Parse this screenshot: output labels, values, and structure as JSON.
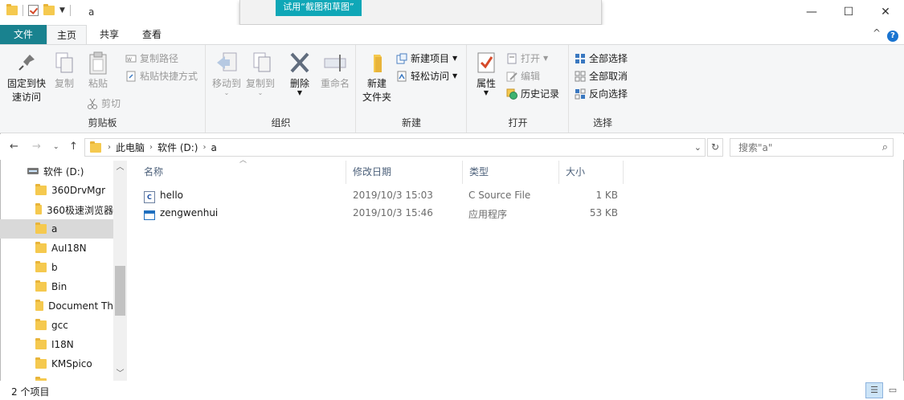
{
  "window": {
    "title": "a",
    "minimize": "—",
    "maximize": "☐",
    "close": "✕"
  },
  "popup": {
    "button": "试用“截图和草图”"
  },
  "tabs": {
    "file": "文件",
    "home": "主页",
    "share": "共享",
    "view": "查看"
  },
  "ribbon": {
    "clipboard": {
      "label": "剪贴板",
      "pin": "固定到快\n速访问",
      "pin_l1": "固定到快",
      "pin_l2": "速访问",
      "copy": "复制",
      "paste": "粘贴",
      "copy_path": "复制路径",
      "paste_shortcut": "粘贴快捷方式",
      "cut": "剪切"
    },
    "organize": {
      "label": "组织",
      "move_to": "移动到",
      "copy_to": "复制到",
      "delete": "删除",
      "rename": "重命名"
    },
    "new": {
      "label": "新建",
      "new_folder_l1": "新建",
      "new_folder_l2": "文件夹",
      "new_item": "新建项目",
      "easy_access": "轻松访问"
    },
    "open": {
      "label": "打开",
      "properties": "属性",
      "open": "打开",
      "edit": "编辑",
      "history": "历史记录"
    },
    "select": {
      "label": "选择",
      "select_all": "全部选择",
      "select_none": "全部取消",
      "invert": "反向选择"
    }
  },
  "address": {
    "crumbs": [
      "此电脑",
      "软件 (D:)",
      "a"
    ],
    "search_placeholder": "搜索\"a\""
  },
  "navpane": {
    "items": [
      {
        "label": "软件 (D:)",
        "type": "drive"
      },
      {
        "label": "360DrvMgr",
        "type": "folder"
      },
      {
        "label": "360极速浏览器",
        "type": "folder"
      },
      {
        "label": "a",
        "type": "folder",
        "selected": true
      },
      {
        "label": "AuI18N",
        "type": "folder"
      },
      {
        "label": "b",
        "type": "folder"
      },
      {
        "label": "Bin",
        "type": "folder"
      },
      {
        "label": "Document Th",
        "type": "folder"
      },
      {
        "label": "gcc",
        "type": "folder"
      },
      {
        "label": "I18N",
        "type": "folder"
      },
      {
        "label": "KMSpico",
        "type": "folder"
      }
    ]
  },
  "columns": {
    "name": "名称",
    "modified": "修改日期",
    "type": "类型",
    "size": "大小"
  },
  "files": [
    {
      "name": "hello",
      "modified": "2019/10/3 15:03",
      "type": "C Source File",
      "size": "1 KB",
      "icon": "c-source-icon"
    },
    {
      "name": "zengwenhui",
      "modified": "2019/10/3 15:46",
      "type": "应用程序",
      "size": "53 KB",
      "icon": "exe-icon"
    }
  ],
  "status": {
    "count": "2 个项目"
  }
}
